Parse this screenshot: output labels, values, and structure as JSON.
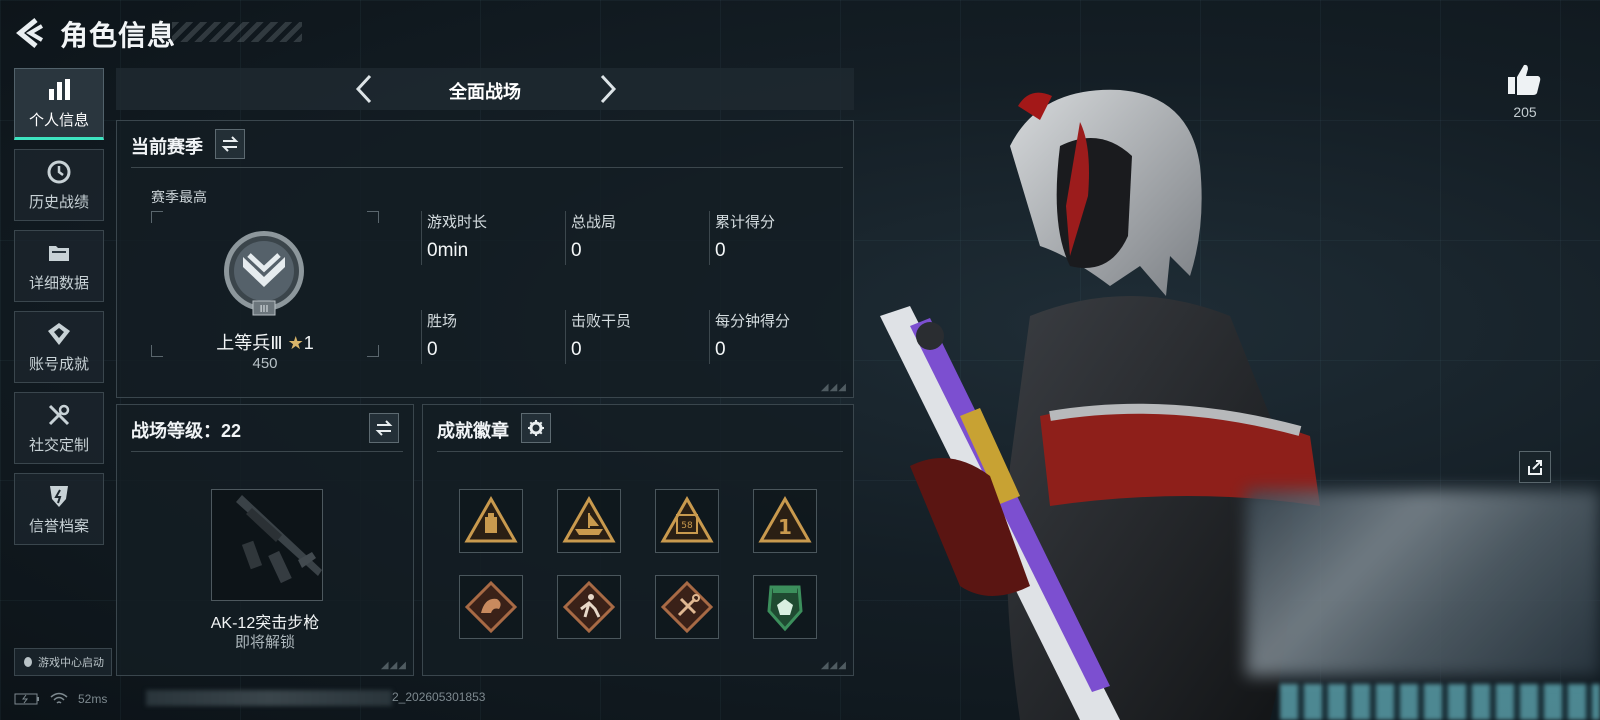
{
  "header": {
    "title": "角色信息"
  },
  "sidebar": {
    "items": [
      {
        "label": "个人信息",
        "icon": "bar-chart-icon",
        "active": true
      },
      {
        "label": "历史战绩",
        "icon": "history-icon"
      },
      {
        "label": "详细数据",
        "icon": "folder-icon"
      },
      {
        "label": "账号成就",
        "icon": "achievement-icon"
      },
      {
        "label": "社交定制",
        "icon": "tools-icon"
      },
      {
        "label": "信誉档案",
        "icon": "shield-icon"
      }
    ],
    "launch_label": "游戏中心启动"
  },
  "mode": {
    "title": "全面战场"
  },
  "season": {
    "heading": "当前赛季",
    "best_label": "赛季最高",
    "rank_name": "上等兵Ⅲ",
    "rank_stars": "1",
    "rank_points": "450",
    "rank_roman": "III",
    "stats": [
      {
        "label": "游戏时长",
        "value": "0min"
      },
      {
        "label": "总战局",
        "value": "0"
      },
      {
        "label": "累计得分",
        "value": "0"
      },
      {
        "label": "胜场",
        "value": "0"
      },
      {
        "label": "击败干员",
        "value": "0"
      },
      {
        "label": "每分钟得分",
        "value": "0"
      }
    ]
  },
  "battlefield": {
    "heading": "战场等级：22",
    "weapon_name": "AK-12突击步枪",
    "weapon_state": "即将解锁"
  },
  "badges": {
    "heading": "成就徽章",
    "items": [
      "supply-badge-icon",
      "boat-badge-icon",
      "ammo-badge-icon",
      "rank-one-badge-icon",
      "dragon-badge-icon",
      "runner-badge-icon",
      "tools-badge-icon",
      "green-shield-badge-icon"
    ],
    "ammo_text": "58",
    "one_text": "1"
  },
  "profile": {
    "likes": "205"
  },
  "status_bar": {
    "ping": "52ms",
    "uid_suffix": "2_202605301853"
  },
  "colors": {
    "accent": "#3de3c0",
    "badge_gold": "#c99a4e",
    "badge_bronze": "#a86a45",
    "badge_green": "#3c8f5c"
  }
}
